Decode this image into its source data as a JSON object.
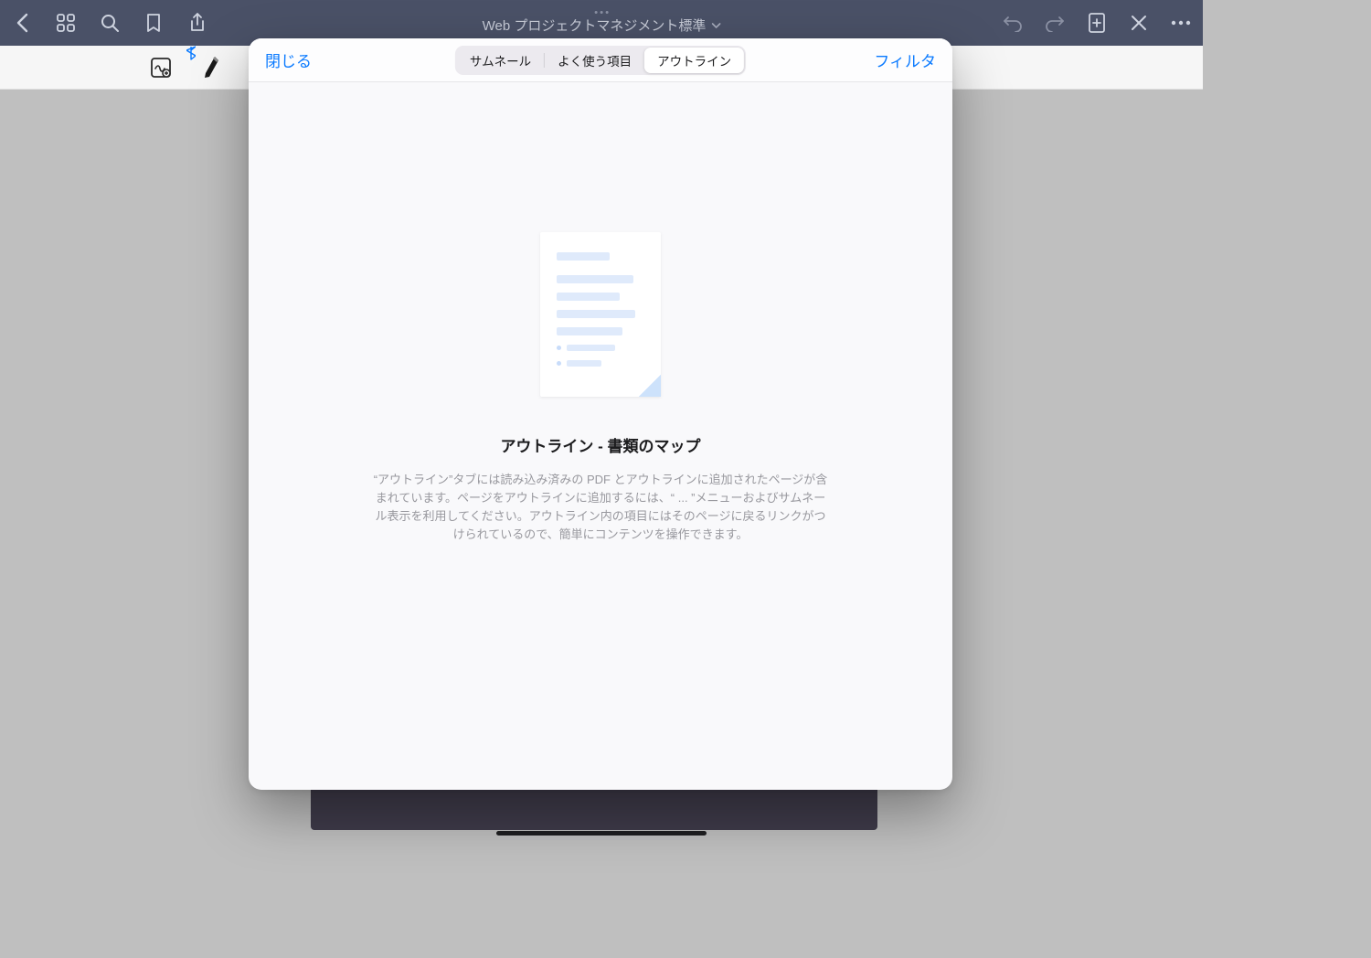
{
  "nav": {
    "title": "Web プロジェクトマネジメント標準"
  },
  "modal": {
    "close_label": "閉じる",
    "filter_label": "フィルタ",
    "tabs": {
      "thumbnails": "サムネール",
      "favorites": "よく使う項目",
      "outline": "アウトライン"
    },
    "empty": {
      "title": "アウトライン - 書類のマップ",
      "description": "“アウトライン”タブには読み込み済みの PDF とアウトラインに追加されたページが含まれています。ページをアウトラインに追加するには、“ ... ”メニューおよびサムネール表示を利用してください。アウトライン内の項目にはそのページに戻るリンクがつけられているので、簡単にコンテンツを操作できます。"
    }
  }
}
